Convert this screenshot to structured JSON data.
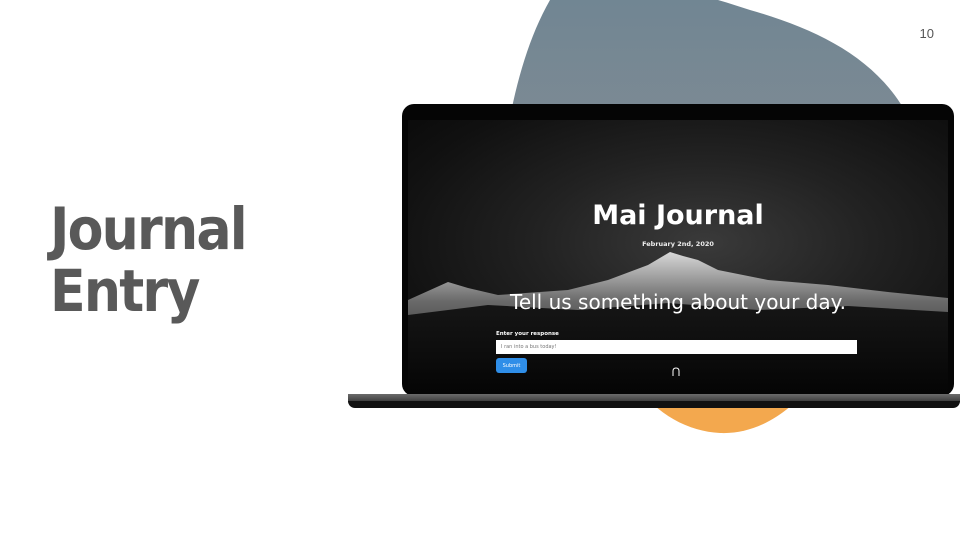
{
  "slide": {
    "number": "10",
    "title_line1": "Journal",
    "title_line2": "Entry"
  },
  "colors": {
    "blob_blue": "#6f8593",
    "blob_orange": "#f3a84e",
    "title_gray": "#595959",
    "submit_blue": "#2f8ee8"
  },
  "app": {
    "title": "Mai Journal",
    "date": "February 2nd, 2020",
    "prompt": "Tell us something about your day.",
    "field_label": "Enter your response",
    "input_placeholder": "I ran into a bus today!",
    "submit_label": "Submit",
    "scroll_icon": "chevron-up-icon"
  }
}
